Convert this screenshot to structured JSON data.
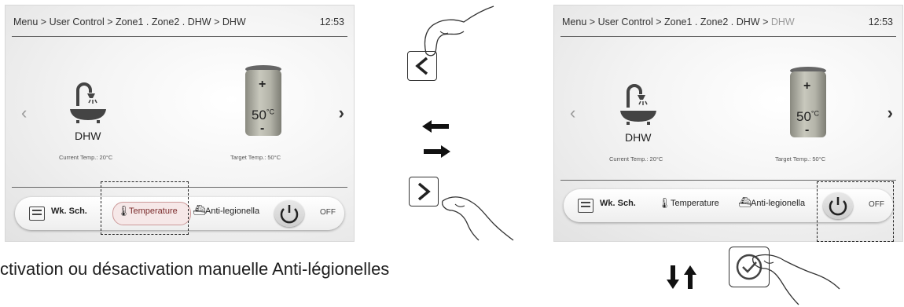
{
  "screens": [
    {
      "breadcrumb": {
        "menu": "Menu",
        "sep": ">",
        "user_control": "User Control",
        "zones": "Zone1 . Zone2 . DHW",
        "current": "DHW"
      },
      "time": "12:53",
      "zone_label": "DHW",
      "current_temp": "Current Temp.: 20°C",
      "target_temp": "Target Temp.: 50°C",
      "tank_value": "50",
      "tank_unit": "°C",
      "plus": "+",
      "minus": "-",
      "bottom_bar": {
        "schedule": "Wk. Sch.",
        "temperature": "Temperature",
        "anti_legionella": "Anti-legionella",
        "power_state": "OFF"
      }
    },
    {
      "breadcrumb": {
        "menu": "Menu",
        "sep": ">",
        "user_control": "User Control",
        "zones": "Zone1 . Zone2 . DHW",
        "current": "DHW"
      },
      "time": "12:53",
      "zone_label": "DHW",
      "current_temp": "Current Temp.: 20°C",
      "target_temp": "Target Temp.: 50°C",
      "tank_value": "50",
      "tank_unit": "°C",
      "plus": "+",
      "minus": "-",
      "bottom_bar": {
        "schedule": "Wk. Sch.",
        "temperature": "Temperature",
        "anti_legionella": "Anti-legionella",
        "power_state": "OFF"
      }
    }
  ],
  "nav": {
    "prev": "‹",
    "next": "›"
  },
  "caption": "ctivation ou désactivation manuelle Anti-légionelles",
  "icons": [
    "faucet-icon",
    "tank-icon",
    "schedule-icon",
    "thermometer-icon",
    "anti-legionella-icon",
    "power-icon",
    "back-key-icon",
    "forward-key-icon",
    "confirm-key-icon",
    "hand-pointer-icon",
    "arrow-left-icon",
    "arrow-right-icon",
    "arrow-down-icon",
    "arrow-up-icon"
  ]
}
